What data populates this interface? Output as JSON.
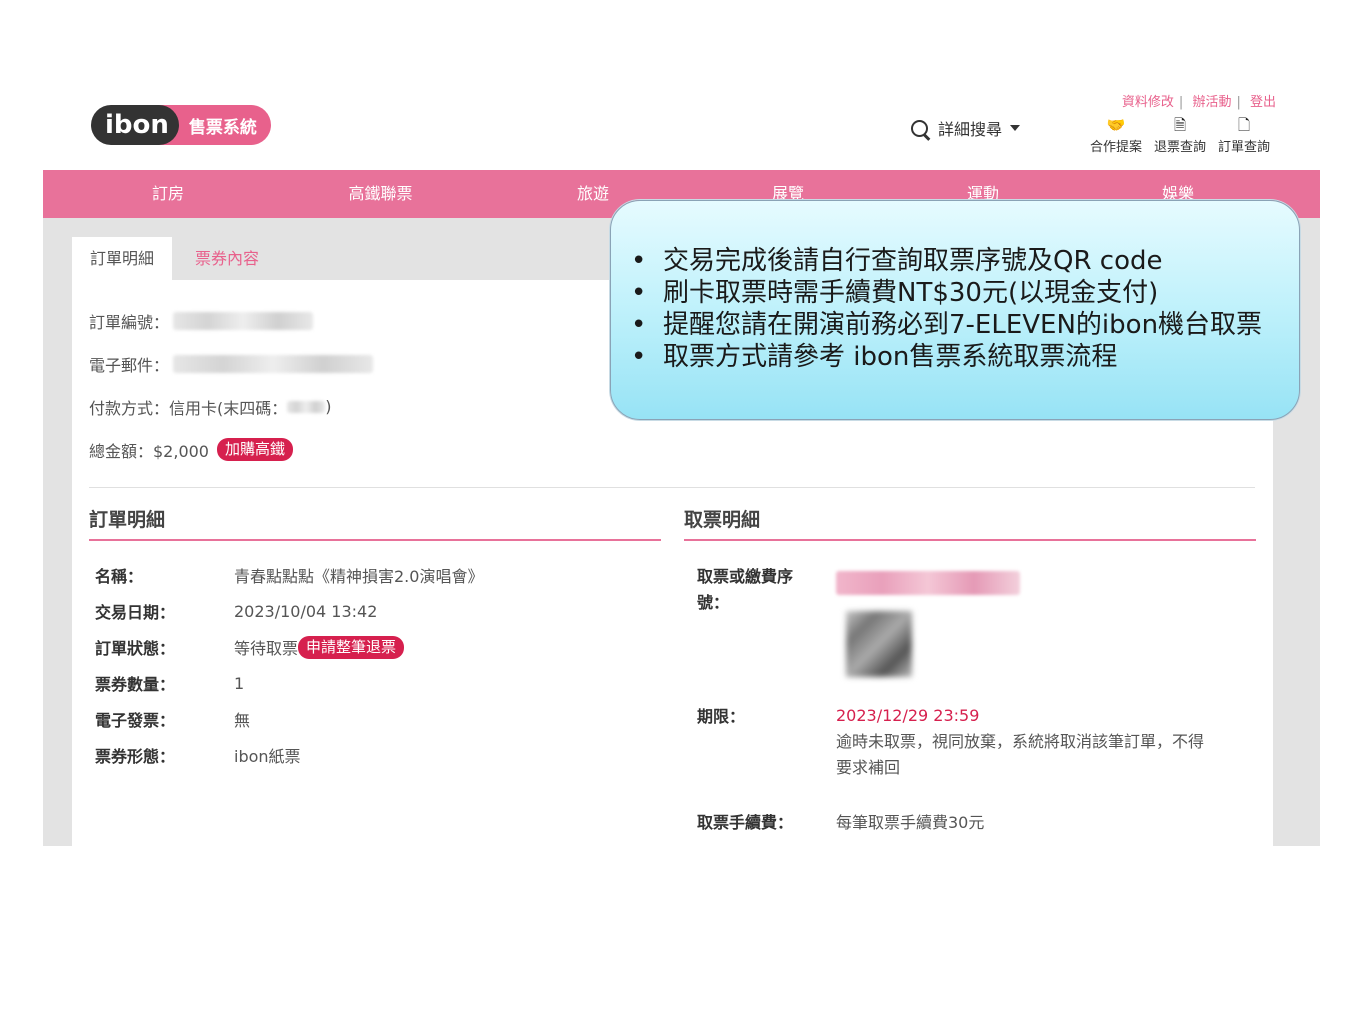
{
  "header": {
    "logo_text": "ibon",
    "logo_tag": "售票系統",
    "search_label": "詳細搜尋",
    "top_links": [
      "資料修改",
      "辦活動",
      "登出"
    ],
    "quick_links": [
      {
        "label": "合作提案",
        "icon": "handshake-icon"
      },
      {
        "label": "退票查詢",
        "icon": "dollar-doc-icon"
      },
      {
        "label": "訂單查詢",
        "icon": "document-icon"
      }
    ]
  },
  "nav": [
    "訂房",
    "高鐵聯票",
    "旅遊",
    "展覽",
    "運動",
    "娛樂"
  ],
  "tabs": [
    "訂單明細",
    "票券內容"
  ],
  "summary": {
    "order_no_label": "訂單編號：",
    "email_label": "電子郵件：",
    "payment_label": "付款方式：信用卡(末四碼：",
    "payment_suffix": ")",
    "total_label": "總金額：$2,000",
    "total_badge": "加購高鐵"
  },
  "order_detail": {
    "title": "訂單明細",
    "rows": [
      {
        "k": "名稱：",
        "v": "青春點點點《精神損害2.0演唱會》"
      },
      {
        "k": "交易日期：",
        "v": "2023/10/04  13:42"
      },
      {
        "k": "訂單狀態：",
        "v": "等待取票",
        "badge": "申請整筆退票"
      },
      {
        "k": "票券數量：",
        "v": "1"
      },
      {
        "k": "電子發票：",
        "v": "無"
      },
      {
        "k": "票券形態：",
        "v": "ibon紙票"
      }
    ]
  },
  "ticket_detail": {
    "title": "取票明細",
    "code_label_1": "取票或繳費序",
    "code_label_2": "號：",
    "deadline_label": "期限：",
    "deadline_value": "2023/12/29  23:59",
    "deadline_note_1": "逾時未取票，視同放棄，系統將取消該筆訂單，不得",
    "deadline_note_2": "要求補回",
    "fee_label": "取票手續費：",
    "fee_value": "每筆取票手續費30元"
  },
  "callout": [
    "交易完成後請自行查詢取票序號及QR code",
    "刷卡取票時需手續費NT$30元(以現金支付)",
    "提醒您請在開演前務必到7-ELEVEN的ibon機台取票",
    "取票方式請參考 ibon售票系統取票流程"
  ],
  "colors": {
    "brand_pink": "#e8729a",
    "badge_red": "#d6204e",
    "callout_blue": "#bff1fb"
  }
}
